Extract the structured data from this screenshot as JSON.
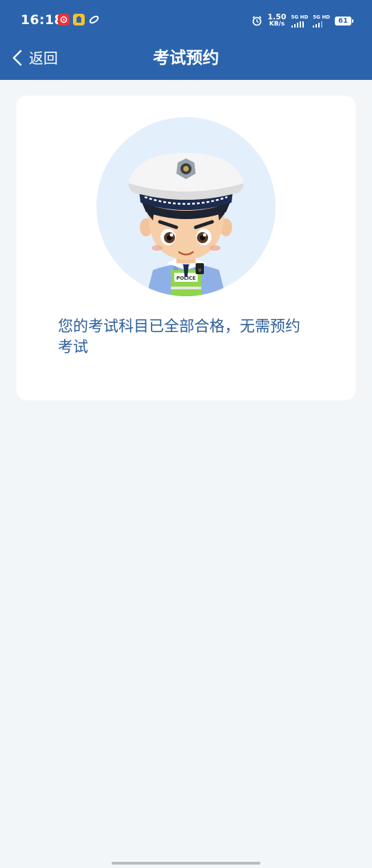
{
  "status_bar": {
    "time": "16:18",
    "net_speed_value": "1.50",
    "net_speed_unit": "KB/s",
    "sim1_label": "5G HD",
    "sim2_label": "5G HD",
    "battery": "61",
    "notification_icons": [
      "netease-music-icon",
      "app-notification-icon",
      "link-icon"
    ],
    "alarm_icon": "alarm-icon"
  },
  "nav": {
    "back_label": "返回",
    "title": "考试预约"
  },
  "content": {
    "message": "您的考试科目已全部合格，无需预约考试",
    "illustration": "police-officer-avatar"
  },
  "colors": {
    "header_bg": "#2b64ad",
    "page_bg": "#f3f6f9",
    "card_bg": "#ffffff",
    "message_text": "#2c5e9a",
    "avatar_circle": "#e4effc"
  }
}
